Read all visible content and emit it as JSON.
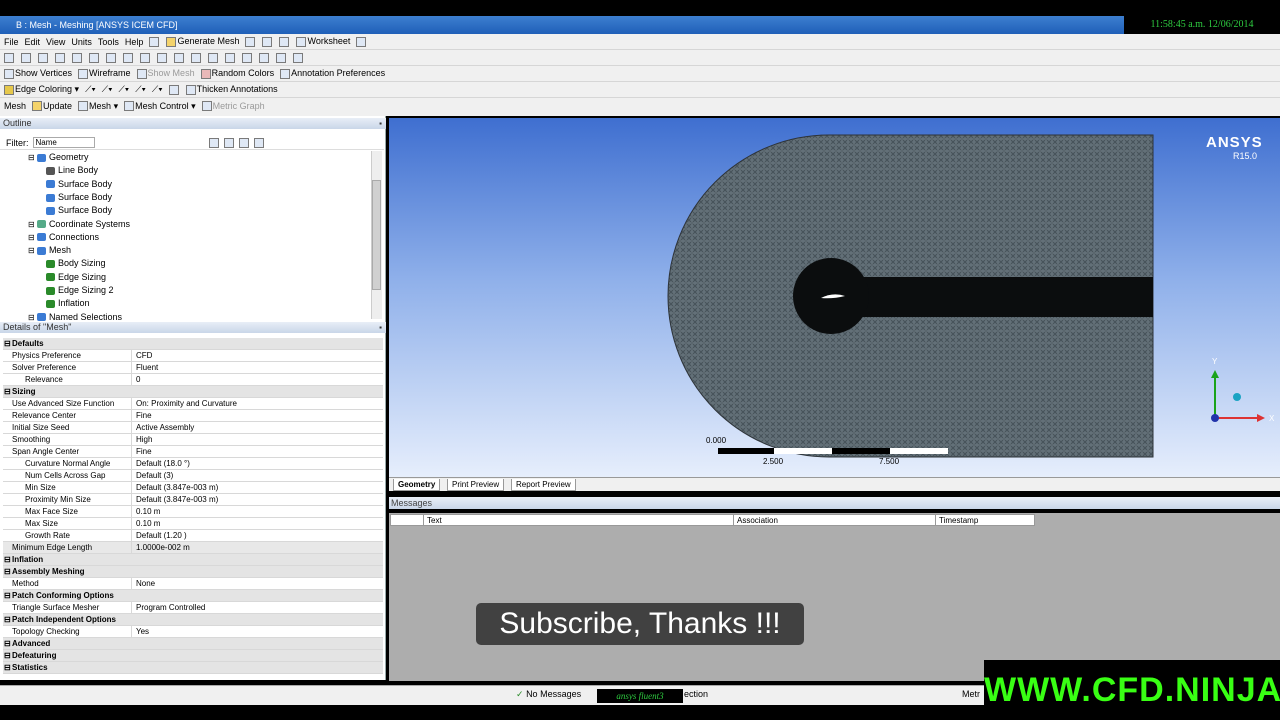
{
  "clock": "11:58:45 a.m. 12/06/2014",
  "title": "B : Mesh - Meshing [ANSYS ICEM CFD]",
  "menu": [
    "File",
    "Edit",
    "View",
    "Units",
    "Tools",
    "Help"
  ],
  "toolbar1": {
    "generate_mesh": "Generate Mesh",
    "worksheet": "Worksheet"
  },
  "toolbar3": {
    "show_vertices": "Show Vertices",
    "wireframe": "Wireframe",
    "show_mesh": "Show Mesh",
    "random_colors": "Random Colors",
    "annotation_prefs": "Annotation Preferences"
  },
  "toolbar4": {
    "edge_coloring": "Edge Coloring",
    "thicken": "Thicken Annotations"
  },
  "toolbar5": {
    "mesh_tab": "Mesh",
    "update": "Update",
    "mesh": "Mesh",
    "mesh_control": "Mesh Control",
    "metric_graph": "Metric Graph"
  },
  "outline": {
    "header": "Outline",
    "filter_label": "Filter:",
    "filter_value": "Name",
    "tree": [
      {
        "label": "Geometry",
        "depth": 1,
        "color": "#3b7bd4"
      },
      {
        "label": "Line Body",
        "depth": 2,
        "color": "#555"
      },
      {
        "label": "Surface Body",
        "depth": 2,
        "color": "#3b7bd4"
      },
      {
        "label": "Surface Body",
        "depth": 2,
        "color": "#3b7bd4"
      },
      {
        "label": "Surface Body",
        "depth": 2,
        "color": "#3b7bd4"
      },
      {
        "label": "Coordinate Systems",
        "depth": 1,
        "color": "#5a8"
      },
      {
        "label": "Connections",
        "depth": 1,
        "color": "#3b7bd4"
      },
      {
        "label": "Mesh",
        "depth": 1,
        "color": "#3b7bd4"
      },
      {
        "label": "Body Sizing",
        "depth": 2,
        "color": "#2a8a2a"
      },
      {
        "label": "Edge Sizing",
        "depth": 2,
        "color": "#2a8a2a"
      },
      {
        "label": "Edge Sizing 2",
        "depth": 2,
        "color": "#2a8a2a"
      },
      {
        "label": "Inflation",
        "depth": 2,
        "color": "#2a8a2a"
      },
      {
        "label": "Named Selections",
        "depth": 1,
        "color": "#3b7bd4"
      }
    ]
  },
  "details": {
    "header": "Details of \"Mesh\"",
    "rows": [
      {
        "k": "Defaults",
        "v": "",
        "type": "cat"
      },
      {
        "k": "Physics Preference",
        "v": "CFD"
      },
      {
        "k": "Solver Preference",
        "v": "Fluent"
      },
      {
        "k": "Relevance",
        "v": "0",
        "type": "ind"
      },
      {
        "k": "Sizing",
        "v": "",
        "type": "cat"
      },
      {
        "k": "Use Advanced Size Function",
        "v": "On: Proximity and Curvature"
      },
      {
        "k": "Relevance Center",
        "v": "Fine"
      },
      {
        "k": "Initial Size Seed",
        "v": "Active Assembly"
      },
      {
        "k": "Smoothing",
        "v": "High"
      },
      {
        "k": "Span Angle Center",
        "v": "Fine"
      },
      {
        "k": "Curvature Normal Angle",
        "v": "Default (18.0 °)",
        "type": "ind"
      },
      {
        "k": "Num Cells Across Gap",
        "v": "Default (3)",
        "type": "ind"
      },
      {
        "k": "Min Size",
        "v": "Default (3.847e-003 m)",
        "type": "ind"
      },
      {
        "k": "Proximity Min Size",
        "v": "Default (3.847e-003 m)",
        "type": "ind"
      },
      {
        "k": "Max Face Size",
        "v": "0.10 m",
        "type": "ind"
      },
      {
        "k": "Max Size",
        "v": "0.10 m",
        "type": "ind"
      },
      {
        "k": "Growth Rate",
        "v": "Default (1.20 )",
        "type": "ind"
      },
      {
        "k": "Minimum Edge Length",
        "v": "1.0000e-002 m",
        "type": "hl"
      },
      {
        "k": "Inflation",
        "v": "",
        "type": "cat"
      },
      {
        "k": "Assembly Meshing",
        "v": "",
        "type": "cat"
      },
      {
        "k": "Method",
        "v": "None"
      },
      {
        "k": "Patch Conforming Options",
        "v": "",
        "type": "cat"
      },
      {
        "k": "Triangle Surface Mesher",
        "v": "Program Controlled"
      },
      {
        "k": "Patch Independent Options",
        "v": "",
        "type": "cat"
      },
      {
        "k": "Topology Checking",
        "v": "Yes"
      },
      {
        "k": "Advanced",
        "v": "",
        "type": "cat"
      },
      {
        "k": "Defeaturing",
        "v": "",
        "type": "cat"
      },
      {
        "k": "Statistics",
        "v": "",
        "type": "cat"
      }
    ]
  },
  "viewport": {
    "logo": "ANSYS",
    "version": "R15.0",
    "scale_labels": [
      "0.000",
      "2.500",
      "7.500"
    ],
    "axes": {
      "y": "Y",
      "x": "X"
    }
  },
  "tabs": [
    "Geometry",
    "Print Preview",
    "Report Preview"
  ],
  "messages": {
    "header": "Messages",
    "cols": [
      "Text",
      "Association",
      "Timestamp"
    ]
  },
  "status": {
    "no_messages": "No Messages",
    "selection": "ection",
    "metric": "Metr"
  },
  "overlay": {
    "subscribe": "Subscribe, Thanks !!!",
    "cfd": "WWW.CFD.NINJA",
    "fluent": "ansys fluent3"
  }
}
